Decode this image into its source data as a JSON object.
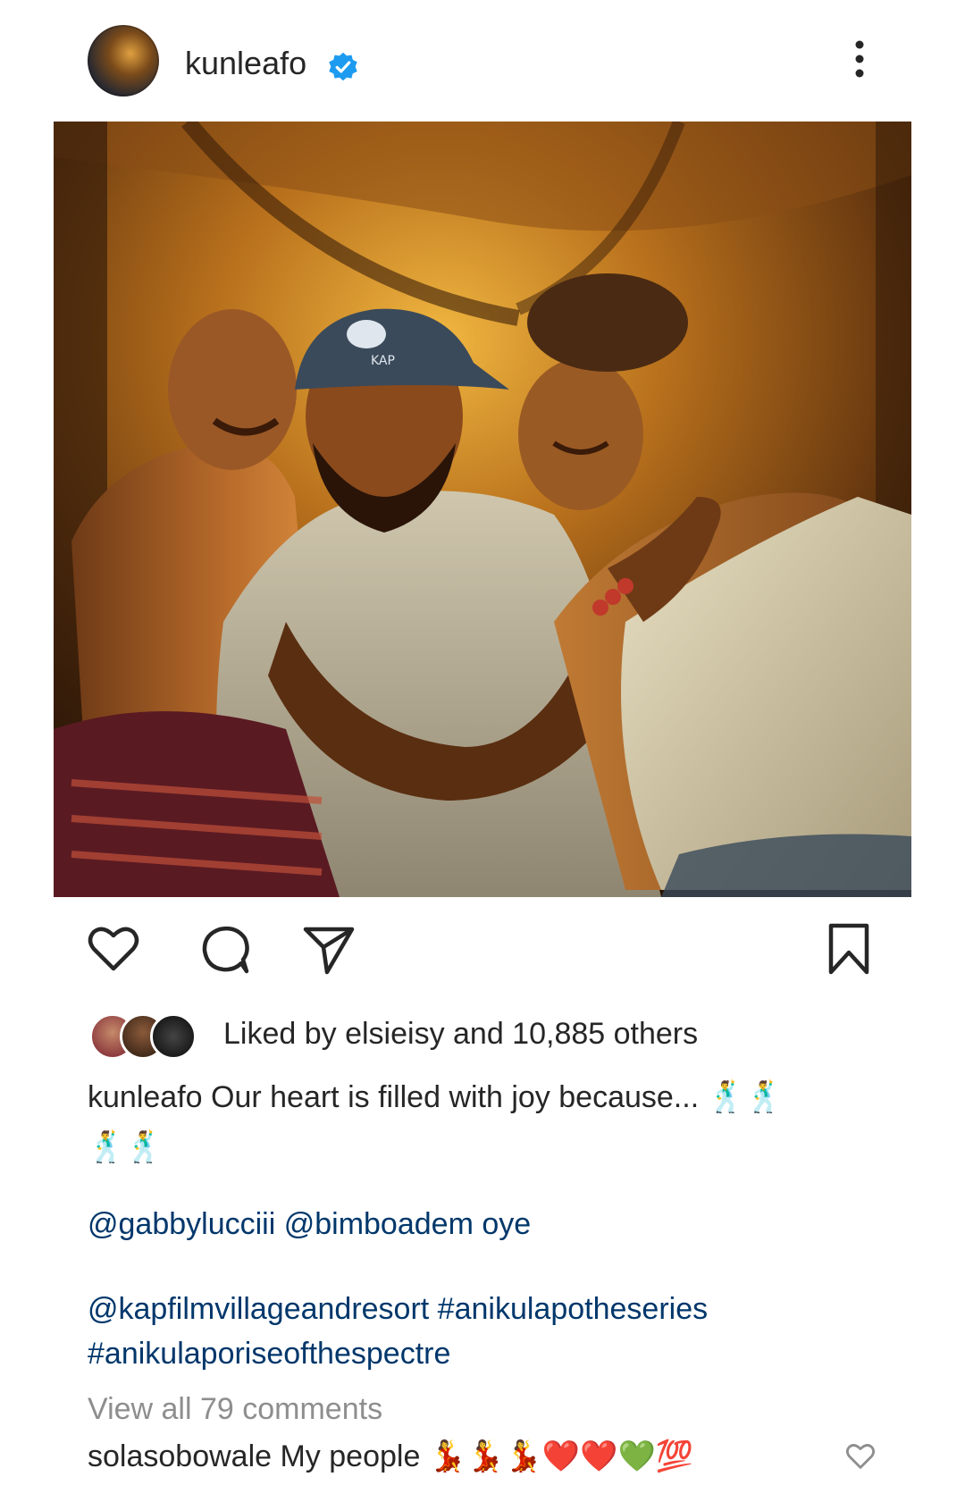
{
  "post": {
    "username": "kunleafo",
    "verified": true,
    "likes_text": "Liked by elsieisy and 10,885 others",
    "caption_user": "kunleafo",
    "caption_text": "Our heart is filled with joy because...",
    "caption_emojis_line1": "🕺🕺",
    "caption_emojis_line2": "🕺🕺",
    "mentions": "@gabbylucciii @bimboadem oye",
    "tags_line1": "@kapfilmvillageandresort #anikulapotheseries",
    "tags_line2": "#anikulaporiseofthespectre",
    "view_all": "View all 79 comments",
    "cap_logo_text": "KAP"
  },
  "comment": {
    "username": "solasobowale",
    "text": "My people",
    "emojis": "💃💃💃❤️❤️💚💯"
  },
  "icons": {
    "avatar": "profile-photo",
    "verified": "verified-badge-icon",
    "more": "more-options-icon",
    "like": "heart-icon",
    "comment": "comment-bubble-icon",
    "share": "paper-plane-icon",
    "save": "bookmark-icon"
  },
  "colors": {
    "verified_blue": "#1d9bf0",
    "link_blue": "#00376b",
    "muted_gray": "#8e8e8e",
    "text_dark": "#262626"
  }
}
